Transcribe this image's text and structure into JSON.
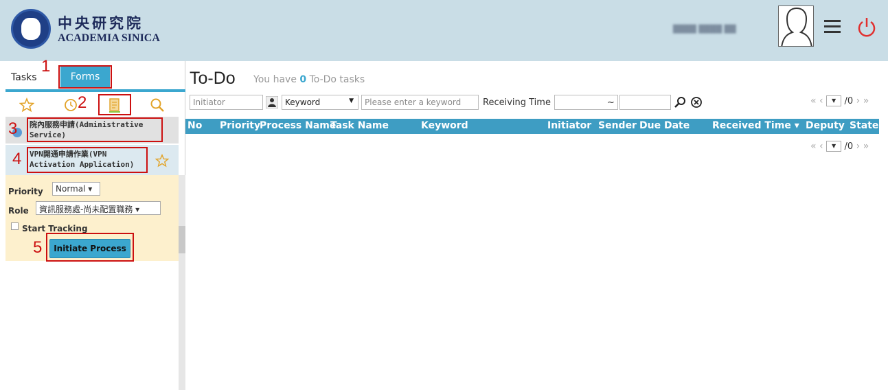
{
  "header": {
    "logo_cn": "中央研究院",
    "logo_en": "ACADEMIA SINICA",
    "user_name": "████ ████ ██"
  },
  "left_panel": {
    "tabs": {
      "tasks_label": "Tasks",
      "forms_label": "Forms"
    },
    "icons": [
      "star-icon",
      "clock-icon",
      "forms-list-icon",
      "search-icon"
    ],
    "list": [
      {
        "label_line1": "院內服務申請(Administrative",
        "label_line2": "Service)"
      },
      {
        "label_line1": "VPN開通申請作業(VPN",
        "label_line2": "Activation Application)"
      }
    ],
    "form": {
      "priority_label": "Priority",
      "priority_value": "Normal ▾",
      "role_label": "Role",
      "role_value": "資訊服務處-尚未配置職務 ▾",
      "tracking_label": "Start Tracking",
      "initiate_label": "Initiate Process"
    },
    "annotations": [
      "1",
      "2",
      "3",
      "4",
      "5"
    ]
  },
  "main": {
    "title": "To-Do",
    "subtitle_pre": "You have ",
    "subtitle_count": "0",
    "subtitle_post": " To-Do tasks",
    "filters": {
      "initiator_placeholder": "Initiator",
      "keyword_select": "Keyword",
      "keyword_placeholder": "Please enter a keyword",
      "receiving_time_label": "Receiving Time",
      "tilde": "~"
    },
    "pager": {
      "page": "/0"
    },
    "columns": [
      "No",
      "Priority",
      "Process Name",
      "Task Name",
      "Keyword",
      "Initiator",
      "Sender",
      "Due Date",
      "Received Time ▾",
      "Deputy",
      "State"
    ]
  },
  "colors": {
    "accent": "#3ba7cf",
    "header_bg": "#c9dde6",
    "annotation": "#cc1010",
    "form_bg": "#fdf0cd"
  }
}
